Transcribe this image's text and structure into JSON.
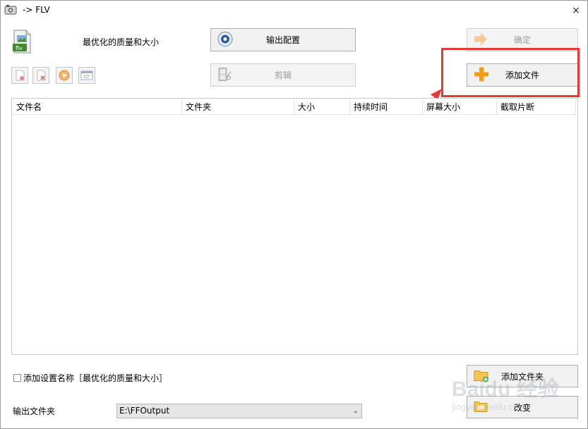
{
  "window": {
    "title": "-> FLV",
    "close_symbol": "×"
  },
  "profile": {
    "label": "最优化的质量和大小",
    "icon": "flv-file-icon",
    "icon_text": "flv"
  },
  "buttons": {
    "output_config": "输出配置",
    "confirm": "确定",
    "edit": "剪辑",
    "add_file": "添加文件",
    "add_folder": "添加文件夹",
    "change": "改变"
  },
  "file_table": {
    "columns": [
      "文件名",
      "文件夹",
      "大小",
      "持续时间",
      "屏幕大小",
      "截取片断"
    ],
    "rows": []
  },
  "bottom": {
    "checkbox_label": "添加设置名称［最优化的质量和大小］",
    "checkbox_checked": false,
    "output_folder_label": "输出文件夹",
    "output_folder_value": "E:\\FFOutput"
  },
  "watermark": {
    "text": "Baidu 经验",
    "subtext": "jingyan.baidu.com"
  },
  "colors": {
    "highlight": "#e53935",
    "add_icon": "#f39c12"
  }
}
